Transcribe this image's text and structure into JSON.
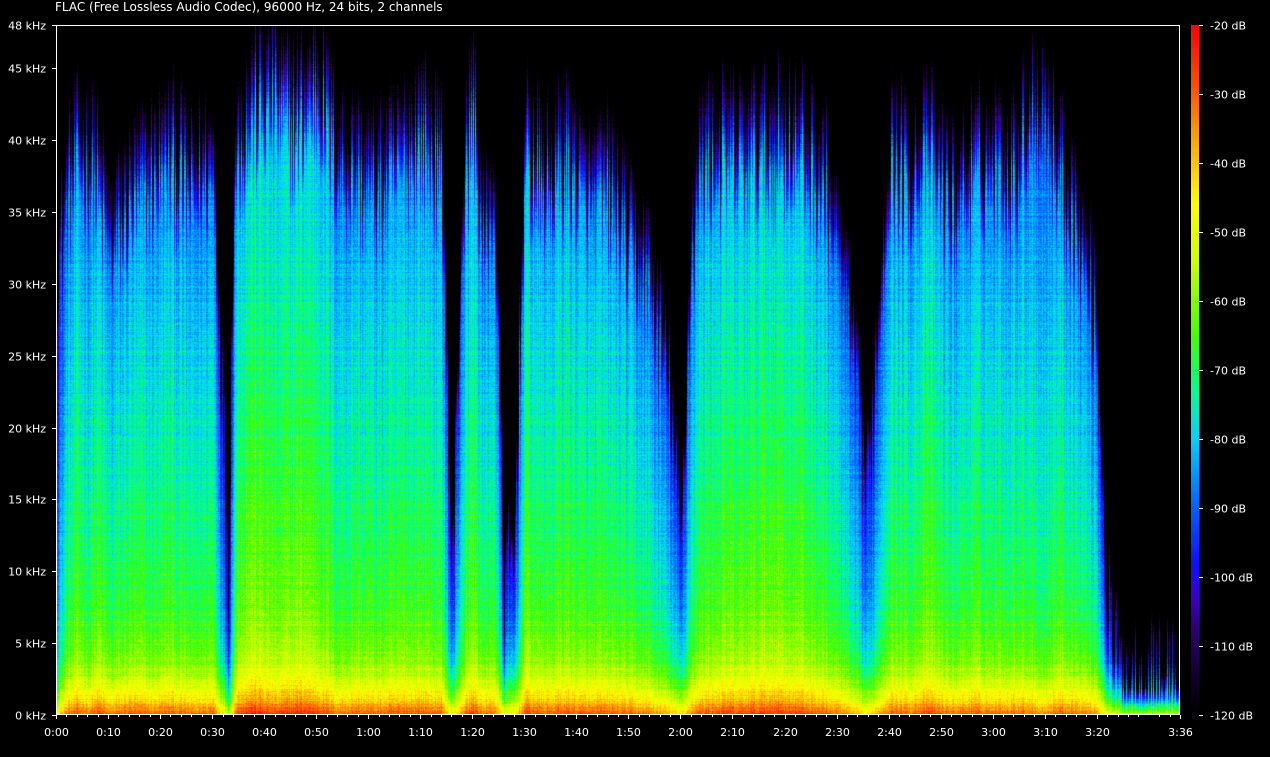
{
  "chart_data": {
    "type": "heatmap",
    "title": "FLAC (Free Lossless Audio Codec), 96000 Hz, 24 bits, 2 channels",
    "y_axis": {
      "min": 0,
      "max": 48,
      "ticks": [
        {
          "value": 0,
          "label": "0 kHz"
        },
        {
          "value": 5,
          "label": "5 kHz"
        },
        {
          "value": 10,
          "label": "10 kHz"
        },
        {
          "value": 15,
          "label": "15 kHz"
        },
        {
          "value": 20,
          "label": "20 kHz"
        },
        {
          "value": 25,
          "label": "25 kHz"
        },
        {
          "value": 30,
          "label": "30 kHz"
        },
        {
          "value": 35,
          "label": "35 kHz"
        },
        {
          "value": 40,
          "label": "40 kHz"
        },
        {
          "value": 45,
          "label": "45 kHz"
        },
        {
          "value": 48,
          "label": "48 kHz"
        }
      ]
    },
    "x_axis": {
      "min": 0,
      "max": 216,
      "ticks": [
        {
          "value": 0,
          "label": "0:00"
        },
        {
          "value": 10,
          "label": "0:10"
        },
        {
          "value": 20,
          "label": "0:20"
        },
        {
          "value": 30,
          "label": "0:30"
        },
        {
          "value": 40,
          "label": "0:40"
        },
        {
          "value": 50,
          "label": "0:50"
        },
        {
          "value": 60,
          "label": "1:00"
        },
        {
          "value": 70,
          "label": "1:10"
        },
        {
          "value": 80,
          "label": "1:20"
        },
        {
          "value": 90,
          "label": "1:30"
        },
        {
          "value": 100,
          "label": "1:40"
        },
        {
          "value": 110,
          "label": "1:50"
        },
        {
          "value": 120,
          "label": "2:00"
        },
        {
          "value": 130,
          "label": "2:10"
        },
        {
          "value": 140,
          "label": "2:20"
        },
        {
          "value": 150,
          "label": "2:30"
        },
        {
          "value": 160,
          "label": "2:40"
        },
        {
          "value": 170,
          "label": "2:50"
        },
        {
          "value": 180,
          "label": "3:00"
        },
        {
          "value": 190,
          "label": "3:10"
        },
        {
          "value": 200,
          "label": "3:20"
        },
        {
          "value": 216,
          "label": "3:36"
        }
      ]
    },
    "colorbar": {
      "min": -120,
      "max": -20,
      "ticks": [
        {
          "value": -20,
          "label": "-20 dB"
        },
        {
          "value": -30,
          "label": "-30 dB"
        },
        {
          "value": -40,
          "label": "-40 dB"
        },
        {
          "value": -50,
          "label": "-50 dB"
        },
        {
          "value": -60,
          "label": "-60 dB"
        },
        {
          "value": -70,
          "label": "-70 dB"
        },
        {
          "value": -80,
          "label": "-80 dB"
        },
        {
          "value": -90,
          "label": "-90 dB"
        },
        {
          "value": -100,
          "label": "-100 dB"
        },
        {
          "value": -110,
          "label": "-110 dB"
        },
        {
          "value": -120,
          "label": "-120 dB"
        }
      ],
      "colors": [
        "#000000",
        "#14002e",
        "#2a006e",
        "#3a00c8",
        "#1010ff",
        "#0060ff",
        "#00d0ff",
        "#00ff90",
        "#40ff00",
        "#d0ff00",
        "#ffff00",
        "#ffb000",
        "#ff5000",
        "#ff0000"
      ]
    },
    "spectrum_profile": {
      "description_free": true,
      "time_points": [
        0,
        2,
        4,
        6,
        8,
        10,
        14,
        18,
        22,
        26,
        30,
        33,
        34,
        35,
        38,
        42,
        46,
        50,
        54,
        58,
        62,
        66,
        70,
        74,
        76,
        78,
        80,
        82,
        84,
        86,
        88,
        90,
        94,
        98,
        102,
        106,
        110,
        114,
        118,
        120,
        122,
        124,
        128,
        132,
        136,
        140,
        144,
        148,
        152,
        156,
        160,
        164,
        168,
        172,
        176,
        180,
        184,
        188,
        190,
        192,
        196,
        200,
        202,
        204,
        206,
        210,
        216
      ],
      "level_dB": [
        -108,
        -95,
        -92,
        -95,
        -90,
        -96,
        -92,
        -94,
        -92,
        -95,
        -93,
        -118,
        -96,
        -88,
        -86,
        -90,
        -86,
        -88,
        -94,
        -92,
        -93,
        -92,
        -91,
        -93,
        -112,
        -96,
        -88,
        -96,
        -92,
        -112,
        -108,
        -90,
        -92,
        -91,
        -93,
        -92,
        -94,
        -96,
        -102,
        -108,
        -96,
        -92,
        -90,
        -90,
        -88,
        -88,
        -90,
        -93,
        -99,
        -108,
        -92,
        -93,
        -90,
        -95,
        -92,
        -94,
        -93,
        -94,
        -98,
        -92,
        -94,
        -98,
        -112,
        -118,
        -118,
        -118,
        -118
      ],
      "bandwidth_kHz": [
        30,
        34,
        36,
        36,
        34,
        30,
        33,
        35,
        36,
        34,
        36,
        10,
        35,
        37,
        39,
        40,
        38,
        41,
        36,
        35,
        34,
        36,
        38,
        35,
        8,
        33,
        40,
        30,
        34,
        8,
        10,
        36,
        34,
        36,
        33,
        34,
        30,
        28,
        20,
        10,
        30,
        36,
        36,
        36,
        36,
        37,
        36,
        34,
        26,
        14,
        36,
        35,
        36,
        33,
        35,
        36,
        35,
        40,
        40,
        36,
        32,
        25,
        8,
        3,
        2,
        2,
        2
      ]
    }
  }
}
